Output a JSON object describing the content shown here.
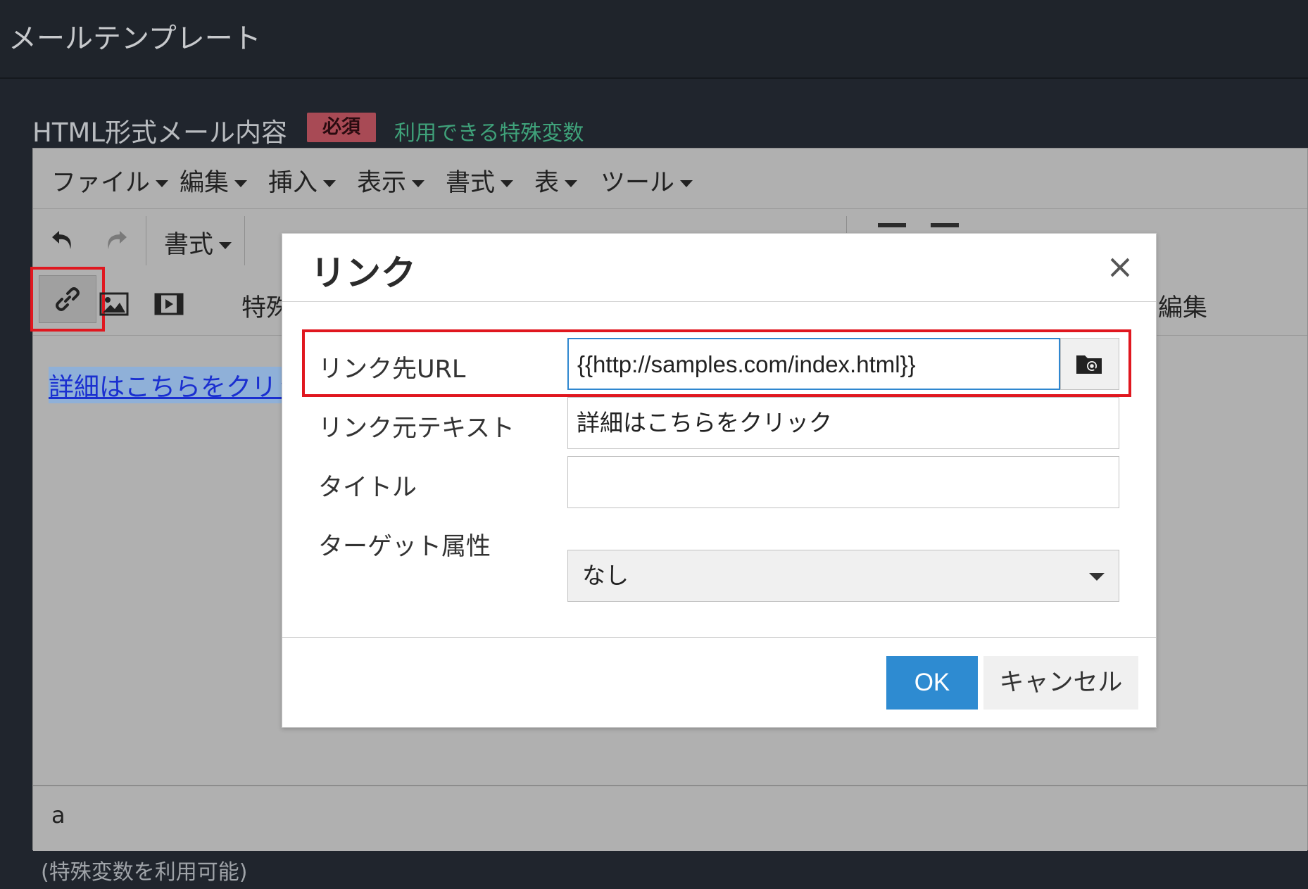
{
  "page": {
    "title": "メールテンプレート"
  },
  "field": {
    "label": "HTML形式メール内容",
    "required_badge": "必須",
    "vars_link": "利用できる特殊変数",
    "footnote": "(特殊変数を利用可能)"
  },
  "editor": {
    "menu": [
      "ファイル",
      "編集",
      "挿入",
      "表示",
      "書式",
      "表",
      "ツール"
    ],
    "toolbar": {
      "format_label": "書式",
      "special_label": "特殊",
      "edit_label": "編集"
    },
    "content_link_text": "詳細はこちらをクリッ",
    "status_path": "a"
  },
  "dialog": {
    "title": "リンク",
    "fields": {
      "url": {
        "label": "リンク先URL",
        "value": "{{http://samples.com/index.html}}"
      },
      "text": {
        "label": "リンク元テキスト",
        "value": "詳細はこちらをクリック"
      },
      "title": {
        "label": "タイトル",
        "value": ""
      },
      "target": {
        "label": "ターゲット属性",
        "value": "なし"
      }
    },
    "ok_label": "OK",
    "cancel_label": "キャンセル"
  },
  "colors": {
    "highlight": "#e0171f",
    "ok_button": "#2e8bd1",
    "required_badge": "#a84a55",
    "vars_link": "#3fa27a"
  }
}
